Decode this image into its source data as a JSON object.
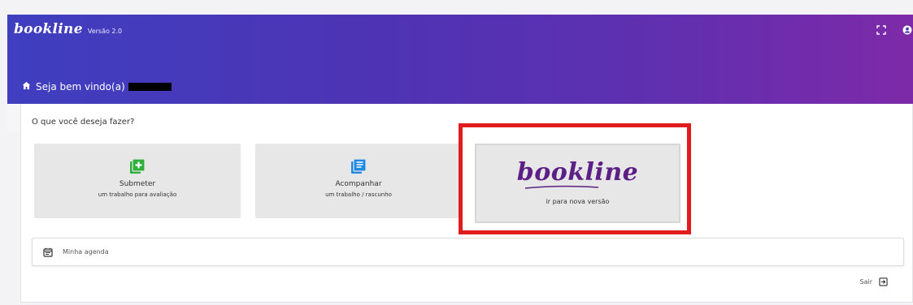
{
  "header": {
    "logo": "bookline",
    "version": "Versão 2.0",
    "welcome": "Seja bem vindo(a)"
  },
  "main": {
    "question": "O que você deseja fazer?",
    "cards": [
      {
        "title": "Submeter",
        "subtitle": "um trabalho para avaliação",
        "icon": "add-document-icon"
      },
      {
        "title": "Acompanhar",
        "subtitle": "um trabalho / rascunho",
        "icon": "documents-icon"
      }
    ],
    "new_version": {
      "brand": "bookline",
      "label": "ir para nova versão"
    },
    "agenda": {
      "label": "Minha agenda",
      "icon": "calendar-icon"
    },
    "logout": {
      "label": "Sair",
      "icon": "logout-icon"
    }
  },
  "colors": {
    "header_start": "#3f3fc0",
    "header_end": "#7d2aa8",
    "accent_green": "#2eaf3c",
    "accent_blue": "#1e88e5",
    "brand_purple": "#5b1f86",
    "highlight_red": "#e01c1c"
  }
}
